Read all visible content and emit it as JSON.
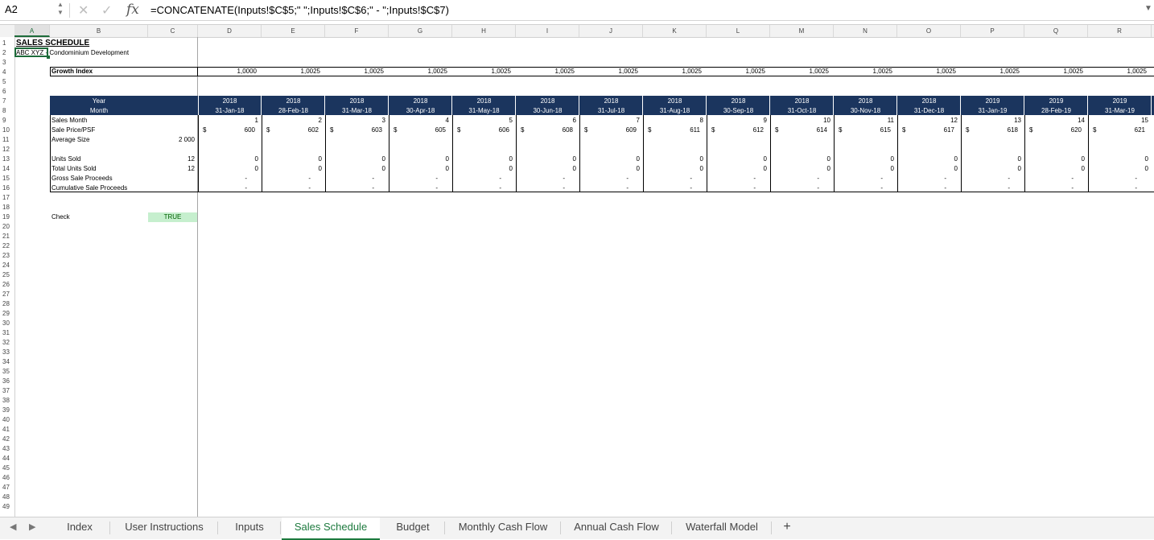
{
  "formula_bar": {
    "cell_ref": "A2",
    "formula": "=CONCATENATE(Inputs!$C$5;\" \";Inputs!$C$6;\" - \";Inputs!$C$7)",
    "fx": "fx"
  },
  "col_labels": [
    "A",
    "B",
    "C",
    "D",
    "E",
    "F",
    "G",
    "H",
    "I",
    "J",
    "K",
    "L",
    "M",
    "N",
    "O",
    "P",
    "Q",
    "R"
  ],
  "row_labels": [
    "1",
    "2",
    "3",
    "4",
    "5",
    "6",
    "7",
    "8",
    "9",
    "10",
    "11",
    "12",
    "13",
    "14",
    "15",
    "16",
    "17",
    "18",
    "19",
    "20",
    "21",
    "22",
    "23",
    "24",
    "25",
    "26",
    "27",
    "28",
    "29",
    "30",
    "31",
    "32",
    "33",
    "34",
    "35",
    "36",
    "37",
    "38",
    "39",
    "40",
    "41",
    "42",
    "43",
    "44",
    "45",
    "46",
    "47",
    "48",
    "49"
  ],
  "sheet": {
    "title": "SALES SCHEDULE",
    "subtitle": "ABC XYZ - Condominium Development",
    "growth_label": "Growth Index",
    "growth": [
      "1,0000",
      "1,0025",
      "1,0025",
      "1,0025",
      "1,0025",
      "1,0025",
      "1,0025",
      "1,0025",
      "1,0025",
      "1,0025",
      "1,0025",
      "1,0025",
      "1,0025",
      "1,0025",
      "1,0025"
    ],
    "year_label": "Year",
    "month_label": "Month",
    "years": [
      "2018",
      "2018",
      "2018",
      "2018",
      "2018",
      "2018",
      "2018",
      "2018",
      "2018",
      "2018",
      "2018",
      "2018",
      "2019",
      "2019",
      "2019"
    ],
    "months": [
      "31-Jan-18",
      "28-Feb-18",
      "31-Mar-18",
      "30-Apr-18",
      "31-May-18",
      "30-Jun-18",
      "31-Jul-18",
      "31-Aug-18",
      "30-Sep-18",
      "31-Oct-18",
      "30-Nov-18",
      "31-Dec-18",
      "31-Jan-19",
      "28-Feb-19",
      "31-Mar-19"
    ],
    "sales_month_label": "Sales Month",
    "sales_month": [
      "1",
      "2",
      "3",
      "4",
      "5",
      "6",
      "7",
      "8",
      "9",
      "10",
      "11",
      "12",
      "13",
      "14",
      "15"
    ],
    "sale_price_label": "Sale Price/PSF",
    "currency": "$",
    "sale_price": [
      "600",
      "602",
      "603",
      "605",
      "606",
      "608",
      "609",
      "611",
      "612",
      "614",
      "615",
      "617",
      "618",
      "620",
      "621"
    ],
    "avg_size_label": "Average Size",
    "avg_size": "2 000",
    "units_sold_label": "Units Sold",
    "units_sold_c": "12",
    "units_sold": [
      "0",
      "0",
      "0",
      "0",
      "0",
      "0",
      "0",
      "0",
      "0",
      "0",
      "0",
      "0",
      "0",
      "0",
      "0"
    ],
    "total_units_label": "Total Units Sold",
    "total_units_c": "12",
    "total_units": [
      "0",
      "0",
      "0",
      "0",
      "0",
      "0",
      "0",
      "0",
      "0",
      "0",
      "0",
      "0",
      "0",
      "0",
      "0"
    ],
    "gross_label": "Gross Sale Proceeds",
    "gross": [
      "-",
      "-",
      "-",
      "-",
      "-",
      "-",
      "-",
      "-",
      "-",
      "-",
      "-",
      "-",
      "-",
      "-",
      "-"
    ],
    "cum_label": "Cumulative Sale Proceeds",
    "cum": [
      "-",
      "-",
      "-",
      "-",
      "-",
      "-",
      "-",
      "-",
      "-",
      "-",
      "-",
      "-",
      "-",
      "-",
      "-"
    ],
    "check_label": "Check",
    "check_value": "TRUE"
  },
  "tabs": [
    "Index",
    "User Instructions",
    "Inputs",
    "Sales Schedule",
    "Budget",
    "Monthly Cash Flow",
    "Annual Cash Flow",
    "Waterfall Model"
  ],
  "active_tab": "Sales Schedule",
  "add_sheet": "+",
  "colors": {
    "navy": "#1b355e",
    "active_green": "#1d7a3e",
    "true_bg": "#c6efce"
  }
}
